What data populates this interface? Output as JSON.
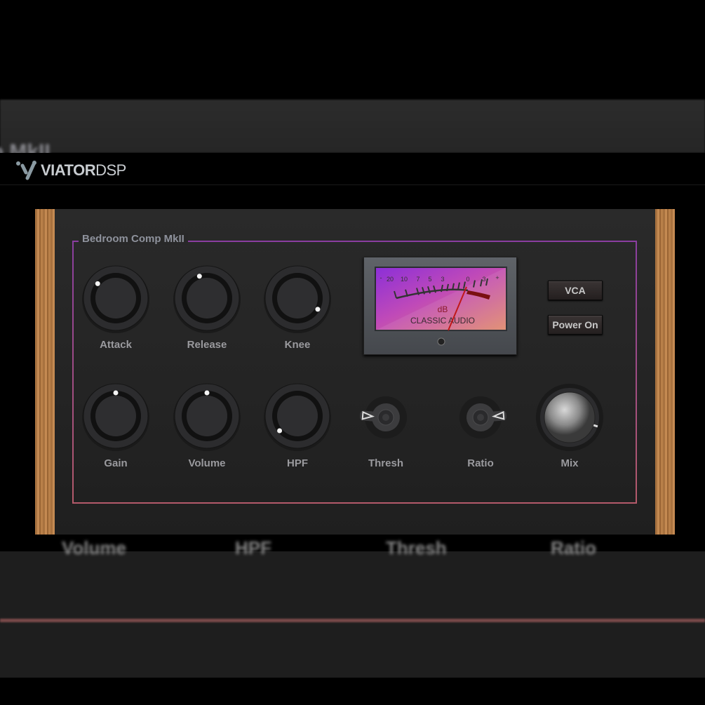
{
  "background": {
    "ghost_title": "mp MkII",
    "ghost_labels": [
      "Volume",
      "HPF",
      "Thresh",
      "Ratio"
    ]
  },
  "header": {
    "logo_bold": "VIATOR",
    "logo_light": "DSP"
  },
  "plugin": {
    "title": "Bedroom Comp MkII",
    "colors": {
      "accent_top": "#8a3ea0",
      "accent_bottom": "#b45a6a",
      "wood": "#b07a45"
    },
    "knobs": [
      {
        "label": "Attack",
        "value": 0.31
      },
      {
        "label": "Release",
        "value": 0.43
      },
      {
        "label": "Knee",
        "value": 0.94
      },
      {
        "label": "Gain",
        "value": 0.5
      },
      {
        "label": "Volume",
        "value": 0.5
      },
      {
        "label": "HPF",
        "value": 0.02
      }
    ],
    "switches": [
      {
        "label": "Thresh",
        "value": 0.85
      },
      {
        "label": "Ratio",
        "value": 0.15
      }
    ],
    "mix": {
      "label": "Mix",
      "value": 0.9
    },
    "meter": {
      "scale": [
        "-",
        "20",
        "10",
        "7",
        "5",
        "3",
        "0",
        "3",
        "+"
      ],
      "unit": "dB",
      "brand": "CLASSIC AUDIO"
    },
    "buttons": {
      "vca": "VCA",
      "power": "Power On"
    }
  }
}
